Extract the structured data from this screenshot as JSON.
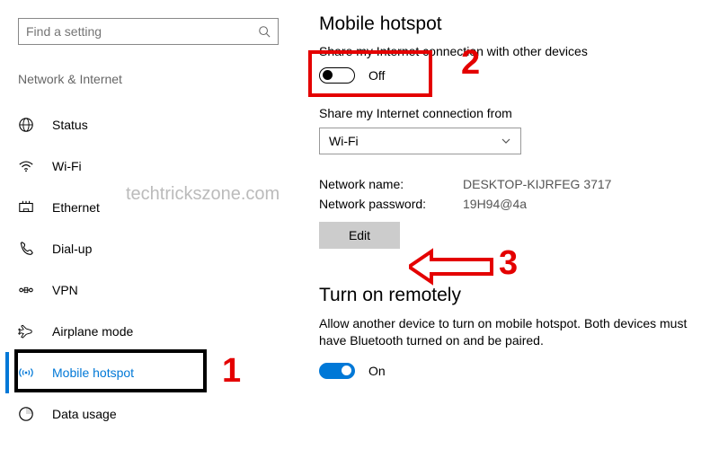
{
  "search": {
    "placeholder": "Find a setting"
  },
  "sidebar": {
    "section": "Network & Internet",
    "items": [
      {
        "label": "Status"
      },
      {
        "label": "Wi-Fi"
      },
      {
        "label": "Ethernet"
      },
      {
        "label": "Dial-up"
      },
      {
        "label": "VPN"
      },
      {
        "label": "Airplane mode"
      },
      {
        "label": "Mobile hotspot"
      },
      {
        "label": "Data usage"
      }
    ]
  },
  "main": {
    "heading": "Mobile hotspot",
    "share_desc": "Share my Internet connection with other devices",
    "share_toggle_label": "Off",
    "share_from_label": "Share my Internet connection from",
    "share_from_value": "Wi-Fi",
    "net_name_label": "Network name:",
    "net_name_value": "DESKTOP-KIJRFEG 3717",
    "net_pw_label": "Network password:",
    "net_pw_value": "19H94@4a",
    "edit_btn": "Edit",
    "remote_heading": "Turn on remotely",
    "remote_desc": "Allow another device to turn on mobile hotspot. Both devices must have Bluetooth turned on and be paired.",
    "remote_toggle_label": "On"
  },
  "watermark": "techtrickszone.com",
  "annotations": {
    "n1": "1",
    "n2": "2",
    "n3": "3"
  }
}
